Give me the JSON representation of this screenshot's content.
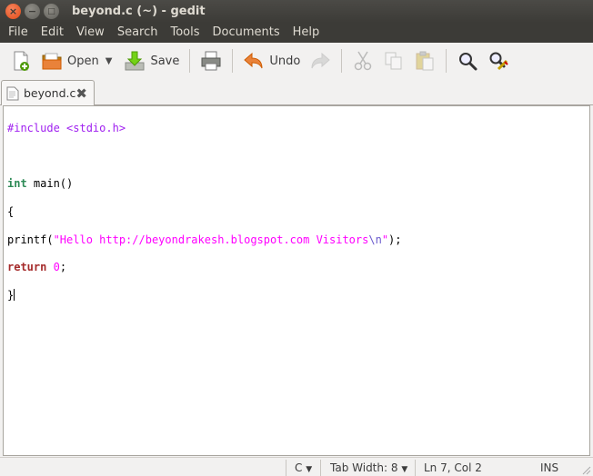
{
  "window": {
    "title": "beyond.c (~) - gedit",
    "controls": {
      "close": "×",
      "minimize": "−",
      "maximize": "□"
    }
  },
  "menu": [
    "File",
    "Edit",
    "View",
    "Search",
    "Tools",
    "Documents",
    "Help"
  ],
  "toolbar": {
    "open_label": "Open",
    "save_label": "Save",
    "undo_label": "Undo",
    "dropdown_arrow": "▼"
  },
  "tab": {
    "label": "beyond.c",
    "close": "✖"
  },
  "code": {
    "include_directive": "#include",
    "include_header": "<stdio.h>",
    "int_kw": "int",
    "main_decl": " main()",
    "open_brace": "{",
    "printf_call": "printf(",
    "string_part": "\"Hello http://beyondrakesh.blogspot.com Visitors",
    "escape": "\\n",
    "string_close": "\"",
    "printf_end": ");",
    "return_kw": "return",
    "return_value": "0",
    "semicolon": ";",
    "close_brace": "}"
  },
  "status": {
    "language": "C",
    "tab_width": "Tab Width:  8",
    "position": "Ln 7, Col 2",
    "mode": "INS",
    "arrow": "▼"
  },
  "colors": {
    "titlebar": "#3c3b37",
    "close_button": "#df4a16",
    "preprocessor": "#a020f0",
    "type_keyword": "#2e8b57",
    "keyword": "#a52a2a",
    "string": "#ff00ff"
  }
}
